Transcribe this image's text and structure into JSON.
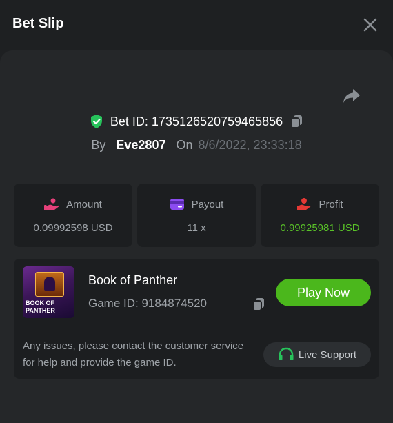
{
  "header": {
    "title": "Bet Slip"
  },
  "bet": {
    "id_text": "Bet ID: 1735126520759465856",
    "by_label": "By",
    "username": "Eve2807",
    "on_label": "On",
    "date": "8/6/2022, 23:33:18"
  },
  "stats": {
    "amount": {
      "label": "Amount",
      "value": "0.09992598 USD"
    },
    "payout": {
      "label": "Payout",
      "value": "11 x"
    },
    "profit": {
      "label": "Profit",
      "value": "0.99925981 USD"
    }
  },
  "game": {
    "name": "Book of Panther",
    "id_text": "Game ID: 9184874520",
    "thumb_text": "BOOK OF PANTHER",
    "play_label": "Play Now",
    "help_text": "Any issues, please contact the customer service for help and provide the game ID.",
    "support_label": "Live Support"
  },
  "icons": {
    "close": "close-icon",
    "share": "share-icon",
    "verified": "shield-check-icon",
    "copy": "copy-icon",
    "amount": "coins-hand-icon",
    "payout": "wallet-card-icon",
    "profit": "profit-hand-icon",
    "support": "headset-icon"
  },
  "colors": {
    "accent_green": "#4bb71c",
    "profit_green": "#59c128",
    "verified_green": "#27c25b",
    "amount_pink": "#e6407a",
    "payout_purple": "#8b4cf0",
    "profit_red": "#e53935"
  }
}
